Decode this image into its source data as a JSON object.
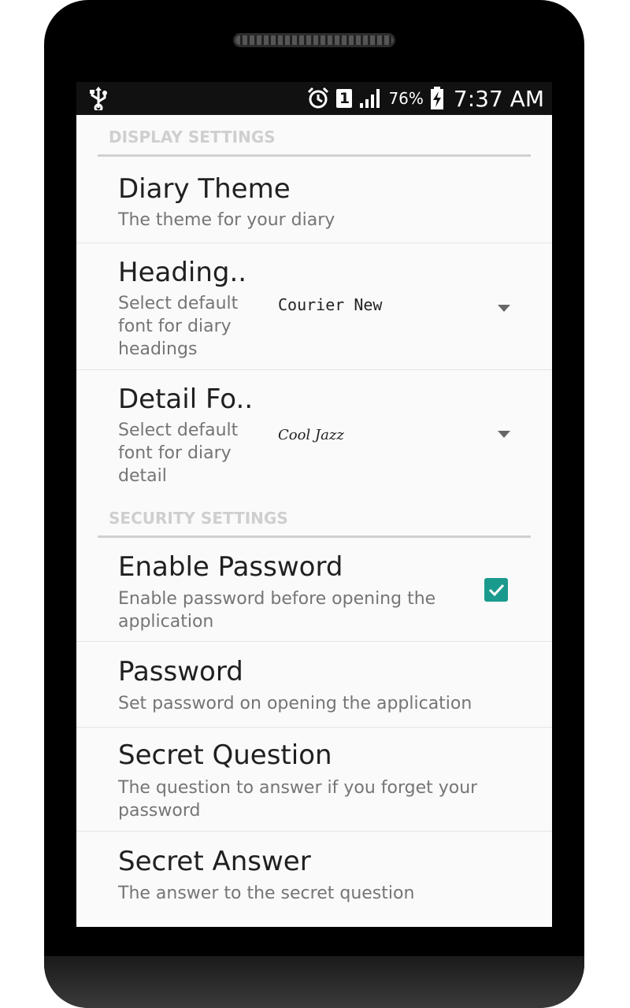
{
  "status_bar": {
    "battery_percent": "76%",
    "time": "7:37 AM",
    "sim_slot": "1",
    "icons": [
      "usb-icon",
      "alarm-icon",
      "sim-icon",
      "signal-icon",
      "battery-charging-icon"
    ]
  },
  "sections": {
    "display": {
      "header": "DISPLAY SETTINGS"
    },
    "security": {
      "header": "SECURITY SETTINGS"
    }
  },
  "prefs": {
    "diary_theme": {
      "title": "Diary Theme",
      "summary": "The theme for your diary"
    },
    "heading_font": {
      "title": "Heading..",
      "summary": "Select default font for diary headings",
      "value": "Courier New"
    },
    "detail_font": {
      "title": "Detail Fo..",
      "summary": "Select default font for diary detail",
      "value": "Cool Jazz"
    },
    "enable_password": {
      "title": "Enable Password",
      "summary": "Enable password before opening the application",
      "checked": true
    },
    "password": {
      "title": "Password",
      "summary": "Set password on opening the application"
    },
    "secret_question": {
      "title": "Secret Question",
      "summary": "The question to answer if you forget your password"
    },
    "secret_answer": {
      "title": "Secret Answer",
      "summary": "The answer to the secret question"
    }
  },
  "colors": {
    "accent": "#1a9a8c",
    "section_header": "#cfcfcf",
    "status_bar": "#111111"
  }
}
